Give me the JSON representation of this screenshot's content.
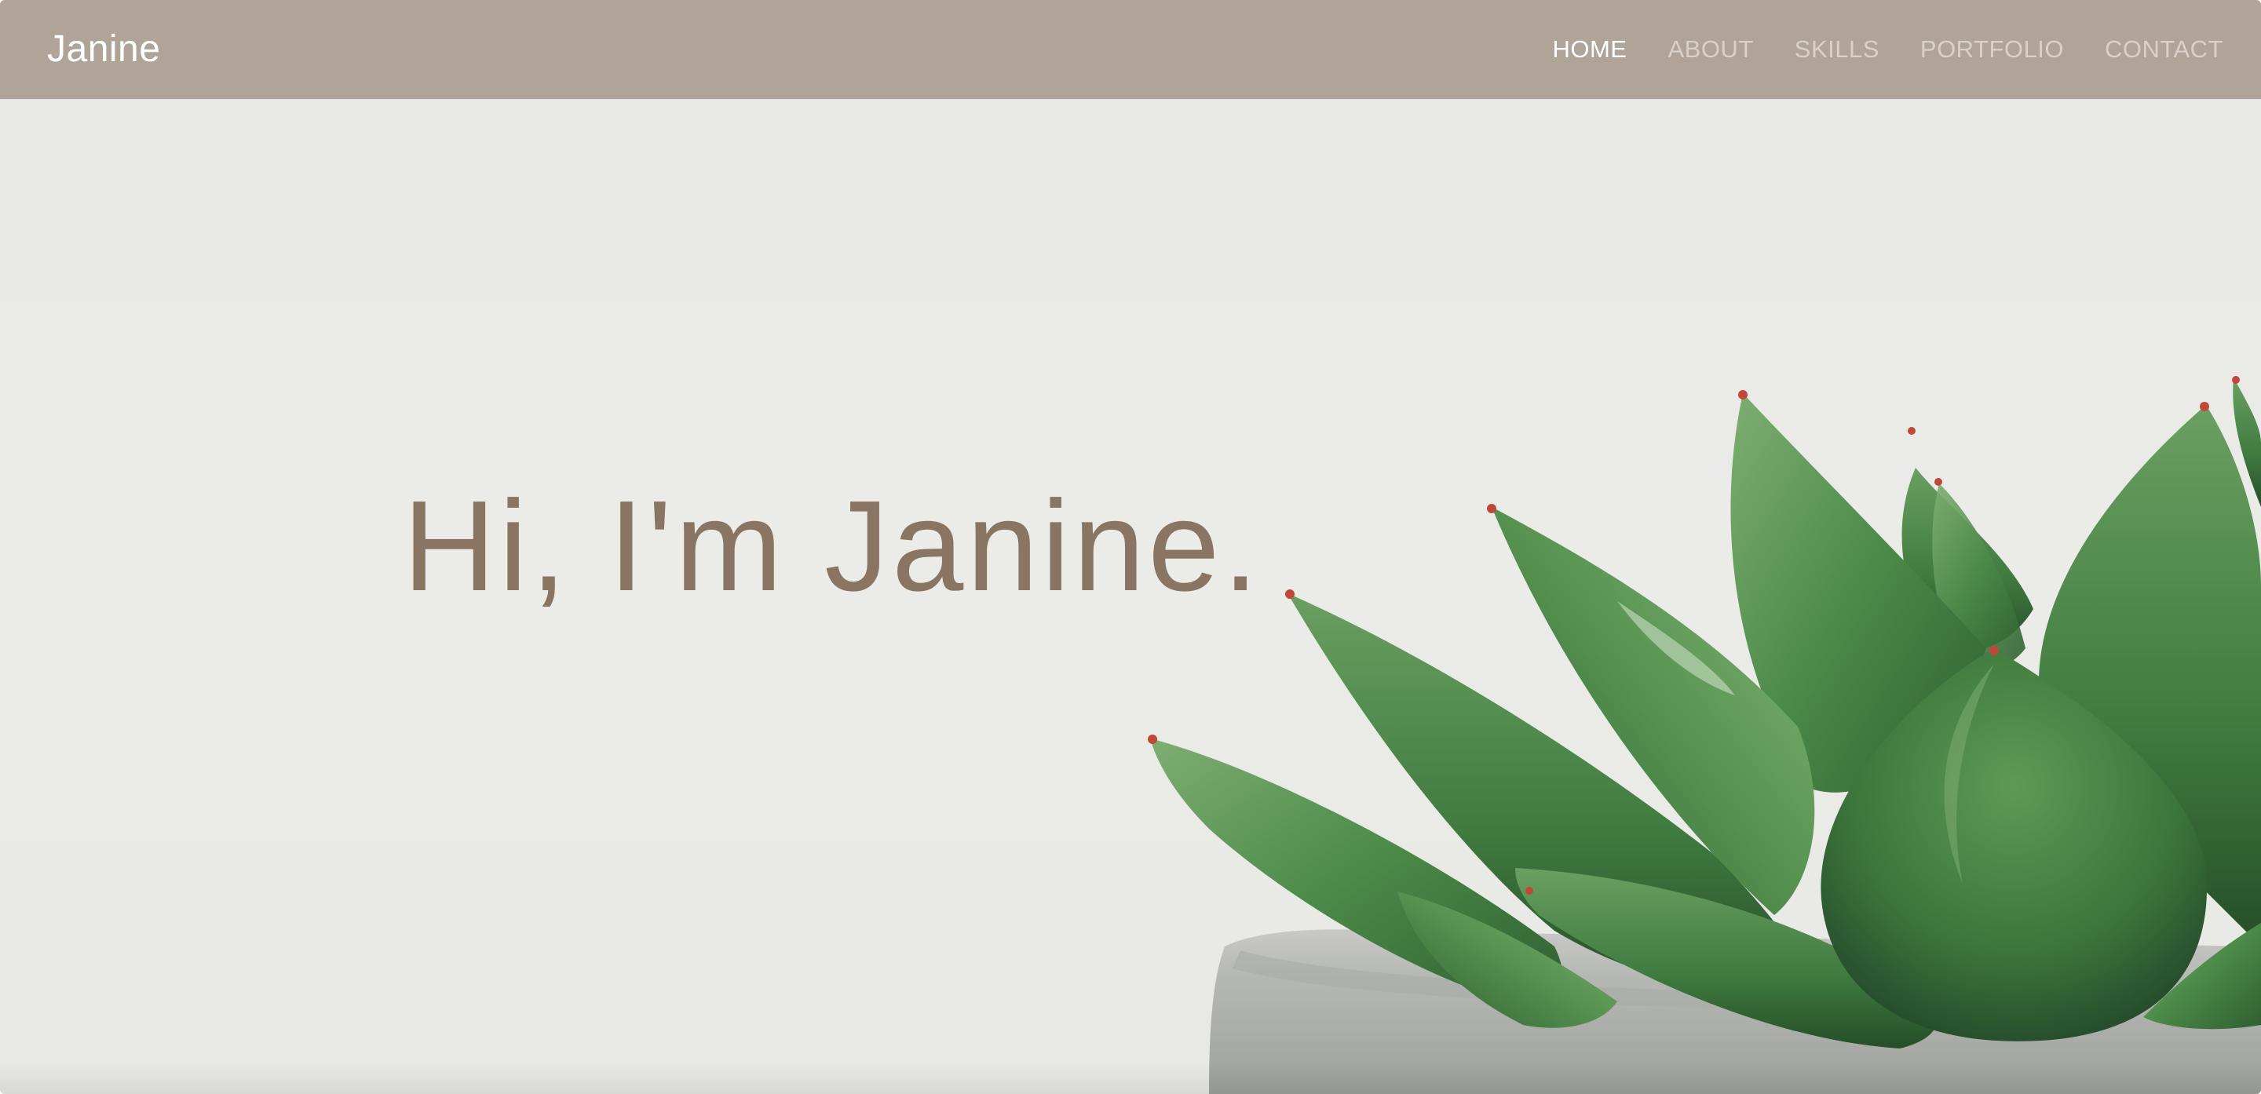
{
  "site": {
    "brand": "Janine"
  },
  "nav": {
    "items": [
      {
        "label": "HOME",
        "active": true
      },
      {
        "label": "ABOUT",
        "active": false
      },
      {
        "label": "SKILLS",
        "active": false
      },
      {
        "label": "PORTFOLIO",
        "active": false
      },
      {
        "label": "CONTACT",
        "active": false
      }
    ]
  },
  "hero": {
    "title": "Hi, I'm Janine.",
    "image_subject": "succulent-plant-in-concrete-pot"
  },
  "colors": {
    "navbar_bg": "#b0a498",
    "nav_active": "#ffffff",
    "nav_inactive": "#d8d1ca",
    "hero_bg": "#e9e9e6",
    "hero_title": "#8a7562",
    "leaf_green": "#3f7a3f"
  }
}
